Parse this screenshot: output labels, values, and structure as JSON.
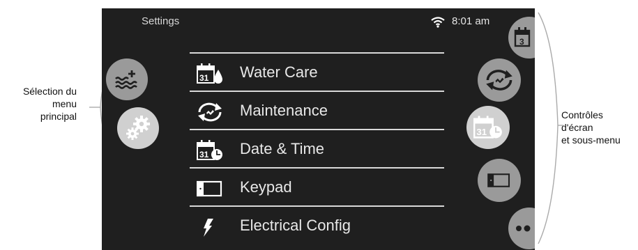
{
  "annotations": {
    "left": [
      "Sélection du",
      "menu",
      "principal"
    ],
    "right": [
      "Contrôles",
      "d'écran",
      "et sous-menu"
    ]
  },
  "status_bar": {
    "title": "Settings",
    "time": "8:01 am",
    "wifi_icon": "wifi-icon"
  },
  "menu": {
    "items": [
      {
        "label": "Water Care",
        "icon": "calendar-drop-icon"
      },
      {
        "label": "Maintenance",
        "icon": "maintenance-cycle-icon"
      },
      {
        "label": "Date & Time",
        "icon": "calendar-clock-icon"
      },
      {
        "label": "Keypad",
        "icon": "keypad-icon"
      },
      {
        "label": "Electrical Config",
        "icon": "lightning-icon"
      }
    ]
  },
  "calendar_day": "31",
  "left_buttons": [
    "water-plus-icon",
    "gears-icon"
  ],
  "right_buttons": [
    "calendar-icon",
    "maintenance-cycle-icon",
    "calendar-clock-icon",
    "keypad-icon",
    "gears-icon"
  ],
  "colors": {
    "screen_bg": "#1f1f1f",
    "button_gray": "#9a9a9a",
    "button_light": "#d0d0d0",
    "text": "#e8e8e8",
    "divider": "#d9d9d9"
  }
}
